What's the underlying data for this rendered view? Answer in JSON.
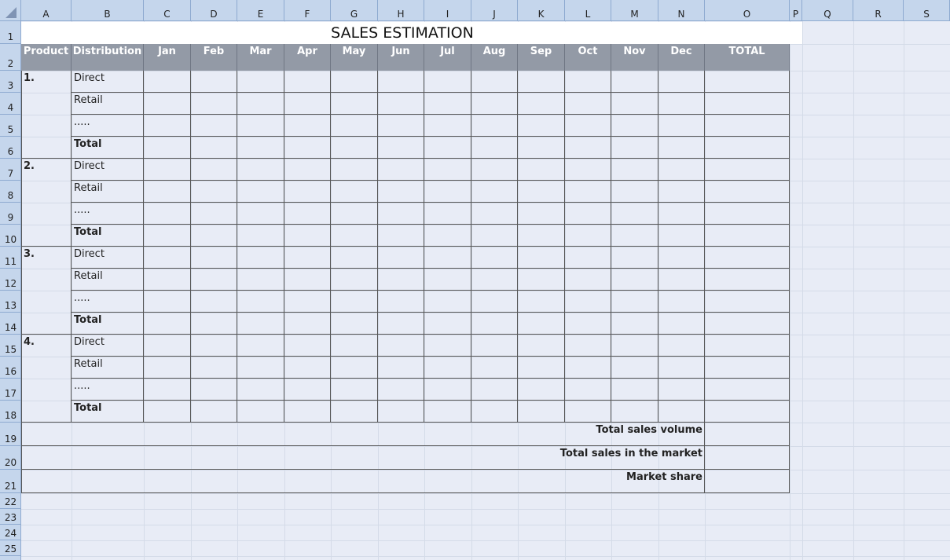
{
  "columns": [
    "A",
    "B",
    "C",
    "D",
    "E",
    "F",
    "G",
    "H",
    "I",
    "J",
    "K",
    "L",
    "M",
    "N",
    "O",
    "P",
    "Q",
    "R",
    "S"
  ],
  "rows": [
    "1",
    "2",
    "3",
    "4",
    "5",
    "6",
    "7",
    "8",
    "9",
    "10",
    "11",
    "12",
    "13",
    "14",
    "15",
    "16",
    "17",
    "18",
    "19",
    "20",
    "21",
    "22",
    "23",
    "24",
    "25"
  ],
  "sheet": {
    "title": "SALES ESTIMATION",
    "headers": {
      "product": "Product",
      "distribution": "Distribution",
      "months": [
        "Jan",
        "Feb",
        "Mar",
        "Apr",
        "May",
        "Jun",
        "Jul",
        "Aug",
        "Sep",
        "Oct",
        "Nov",
        "Dec"
      ],
      "total": "TOTAL"
    },
    "products": [
      {
        "label": "1.",
        "channels": [
          "Direct",
          "Retail",
          ".....",
          "Total"
        ]
      },
      {
        "label": "2.",
        "channels": [
          "Direct",
          "Retail",
          ".....",
          "Total"
        ]
      },
      {
        "label": "3.",
        "channels": [
          "Direct",
          "Retail",
          ".....",
          "Total"
        ]
      },
      {
        "label": "4.",
        "channels": [
          "Direct",
          "Retail",
          ".....",
          "Total"
        ]
      }
    ],
    "summary": [
      "Total sales volume",
      "Total sales in the market",
      "Market share"
    ]
  },
  "colors": {
    "header_bg": "#939aa6",
    "grid_bg": "#e8ecf6",
    "heading_bar": "#c5d6ec"
  }
}
